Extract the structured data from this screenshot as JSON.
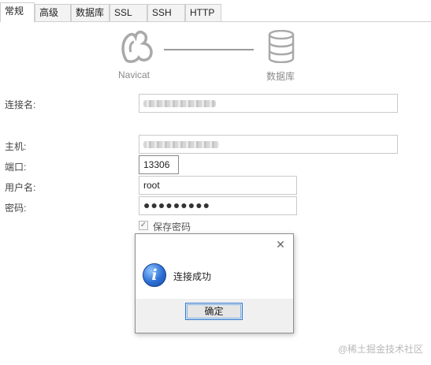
{
  "tabs": [
    {
      "label": "常规",
      "active": true
    },
    {
      "label": "高级",
      "active": false
    },
    {
      "label": "数据库",
      "active": false
    },
    {
      "label": "SSL",
      "active": false
    },
    {
      "label": "SSH",
      "active": false
    },
    {
      "label": "HTTP",
      "active": false
    }
  ],
  "illustration": {
    "left_label": "Navicat",
    "right_label": "数据库",
    "left_icon": "navicat-logo-icon",
    "right_icon": "database-icon"
  },
  "form": {
    "connection_name_label": "连接名:",
    "host_label": "主机:",
    "port_label": "端口:",
    "port_value": "13306",
    "username_label": "用户名:",
    "username_value": "root",
    "password_label": "密码:",
    "password_value": "●●●●●●●●●",
    "save_password_label": "保存密码",
    "save_password_checked": true
  },
  "dialog": {
    "message": "连接成功",
    "ok_label": "确定",
    "close_glyph": "✕",
    "icon": "info-icon"
  },
  "watermark": "@稀土掘金技术社区"
}
